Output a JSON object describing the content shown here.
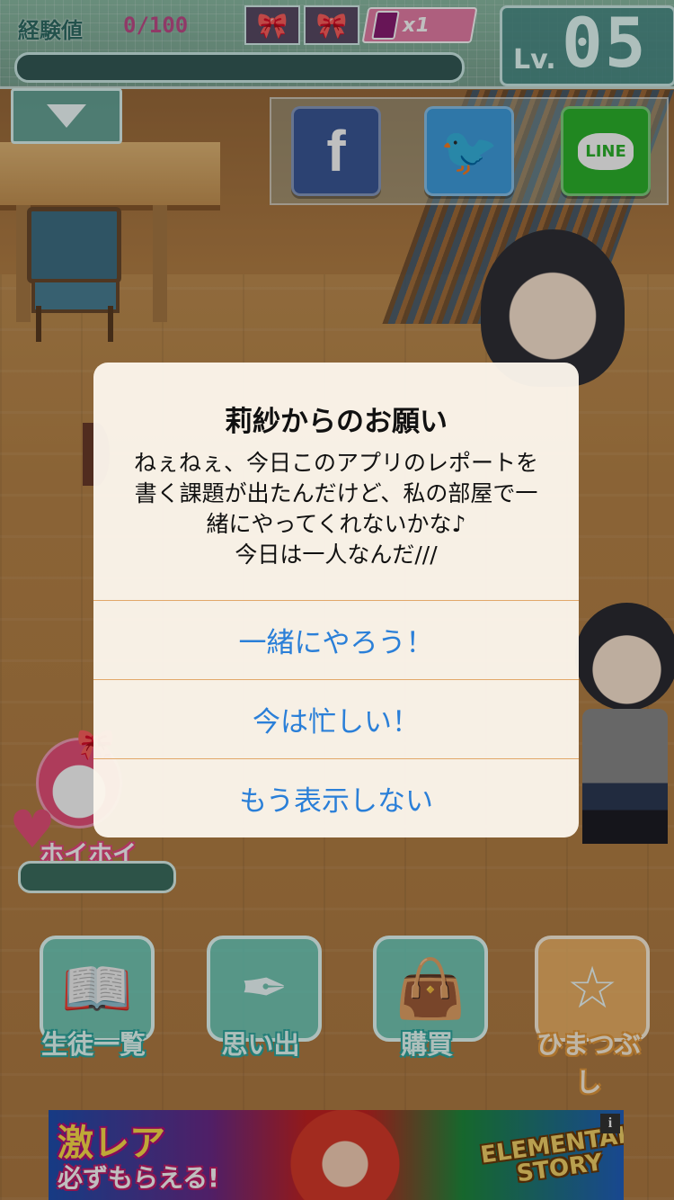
{
  "hud": {
    "exp_label": "経験値",
    "exp_value": "0/100",
    "exp_progress": 0.0,
    "potion_count": "x1",
    "level_prefix": "Lv.",
    "level_number": "05"
  },
  "social": {
    "facebook_glyph": "f",
    "twitter_glyph": "🐦",
    "line_label": "LINE"
  },
  "dialog": {
    "title": "莉紗からのお願い",
    "message_lines": [
      "ねぇねぇ、今日このアプリのレポートを",
      "書く課題が出たんだけど、私の部屋で一",
      "緒にやってくれないかな♪",
      "今日は一人なんだ///"
    ],
    "buttons": [
      "一緒にやろう！",
      "今は忙しい！",
      "もう表示しない"
    ]
  },
  "side": {
    "hoihoi_label": "ホイホイ"
  },
  "menu": {
    "items": [
      {
        "label": "生徒一覧",
        "icon": "book-icon"
      },
      {
        "label": "思い出",
        "icon": "feather-icon"
      },
      {
        "label": "購買",
        "icon": "shopping-bag-icon"
      },
      {
        "label": "ひまつぶし",
        "icon": "star-icon"
      }
    ]
  },
  "ad": {
    "headline": "激レア",
    "subline": "必ずもらえる!",
    "logo_line1": "ELEMENTAL",
    "logo_line2": "STORY",
    "info": "i"
  },
  "colors": {
    "dialog_button_text": "#2a7fd8",
    "hud_teal": "#6fd7c8",
    "exp_value_pink": "#c14d8a"
  }
}
